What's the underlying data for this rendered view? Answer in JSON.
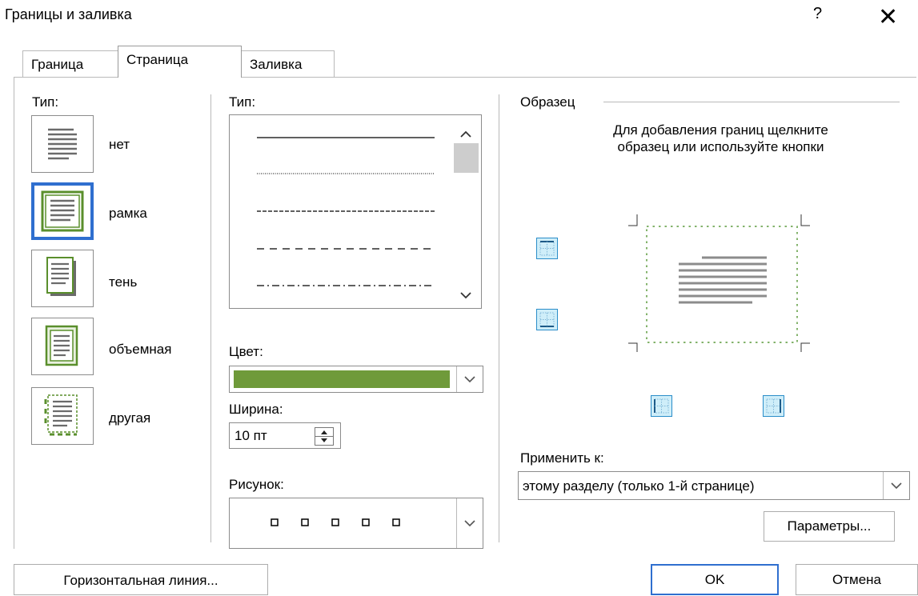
{
  "dialog": {
    "title": "Границы и заливка",
    "help": "?",
    "close": "✕"
  },
  "tabs": [
    {
      "label": "Граница"
    },
    {
      "label": "Страница"
    },
    {
      "label": "Заливка"
    }
  ],
  "type_section": {
    "label": "Тип:",
    "items": [
      {
        "label": "нет"
      },
      {
        "label": "рамка"
      },
      {
        "label": "тень"
      },
      {
        "label": "объемная"
      },
      {
        "label": "другая"
      }
    ]
  },
  "style_section": {
    "label": "Тип:",
    "color_label": "Цвет:",
    "color_value": "#6f9a3a",
    "width_label": "Ширина:",
    "width_value": "10 пт",
    "art_label": "Рисунок:"
  },
  "preview": {
    "label": "Образец",
    "hint": "Для добавления границ щелкните образец или используйте кнопки"
  },
  "apply": {
    "label": "Применить к:",
    "value": "этому разделу (только 1-й странице)"
  },
  "buttons": {
    "options": "Параметры...",
    "horizontal_line": "Горизонтальная линия...",
    "ok": "OK",
    "cancel": "Отмена"
  }
}
